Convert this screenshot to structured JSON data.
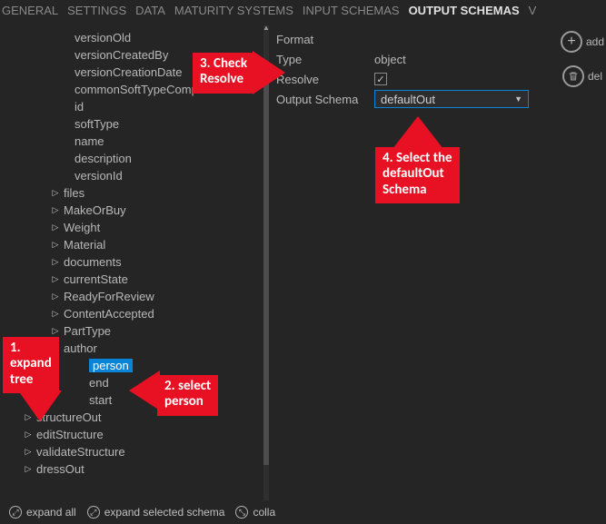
{
  "tabs": {
    "general": "GENERAL",
    "settings": "SETTINGS",
    "data": "DATA",
    "maturity": "MATURITY SYSTEMS",
    "input": "INPUT SCHEMAS",
    "output": "OUTPUT SCHEMAS",
    "overflow": "V"
  },
  "toolbar": {
    "add": "add",
    "delete": "del"
  },
  "tree": {
    "items_leaf": [
      "versionOld",
      "versionCreatedBy",
      "versionCreationDate",
      "commonSoftTypeComp",
      "id",
      "softType",
      "name",
      "description",
      "versionId"
    ],
    "items_expandable": [
      "files",
      "MakeOrBuy",
      "Weight",
      "Material",
      "documents",
      "currentState",
      "ReadyForReview",
      "ContentAccepted",
      "PartType",
      "author"
    ],
    "author_children": [
      "person",
      "end",
      "start"
    ],
    "author_selected": "person",
    "top_level": [
      "structureOut",
      "editStructure",
      "validateStructure",
      "dressOut"
    ]
  },
  "props": {
    "format_label": "Format",
    "type_label": "Type",
    "type_value": "object",
    "resolve_label": "Resolve",
    "resolve_checked": "✓",
    "output_schema_label": "Output Schema",
    "output_schema_value": "defaultOut"
  },
  "footer": {
    "expand_all": "expand all",
    "expand_selected": "expand selected schema",
    "collapse": "colla"
  },
  "annotations": {
    "a1": "1.\nexpand\ntree",
    "a2": "2. select\nperson",
    "a3": "3. Check\nResolve",
    "a4": "4. Select the\ndefaultOut\nSchema"
  }
}
